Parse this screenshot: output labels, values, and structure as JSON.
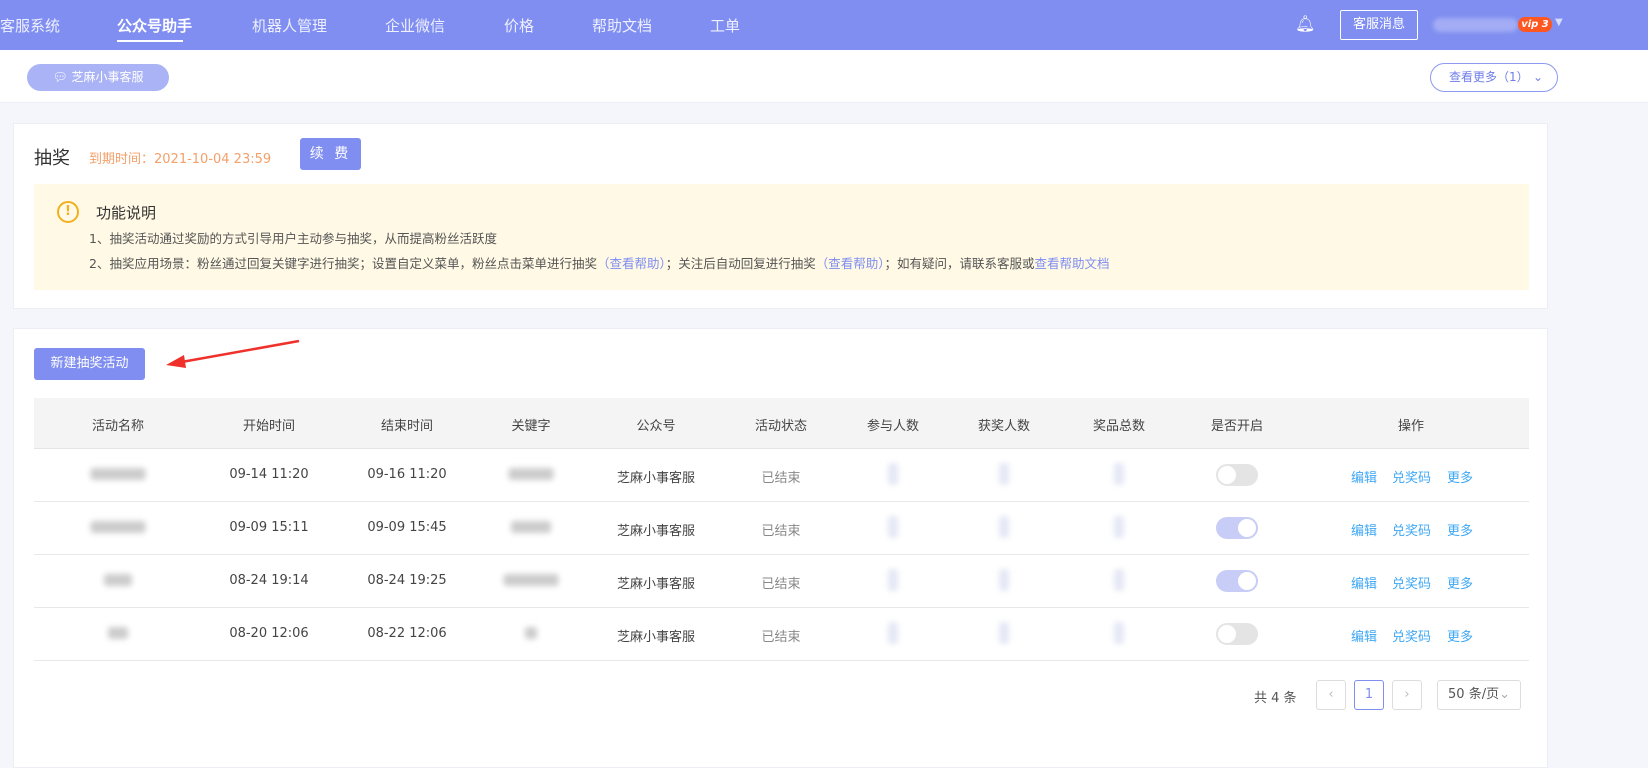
{
  "nav": {
    "items": [
      "客服系统",
      "公众号助手",
      "机器人管理",
      "企业微信",
      "价格",
      "帮助文档",
      "工单"
    ],
    "active": 1,
    "kf_message": "客服消息",
    "vip_badge": "vip 3"
  },
  "subbar": {
    "account": "芝麻小事客服",
    "more": "查看更多（1）"
  },
  "header": {
    "title": "抽奖",
    "expire": "到期时间：2021-10-04 23:59",
    "renew": "续 费"
  },
  "notice": {
    "title": "功能说明",
    "line1": "1、抽奖活动通过奖励的方式引导用户主动参与抽奖，从而提高粉丝活跃度",
    "line2_a": "2、抽奖应用场景：粉丝通过回复关键字进行抽奖；设置自定义菜单，粉丝点击菜单进行抽奖",
    "help1": "（查看帮助）",
    "line2_b": "；关注后自动回复进行抽奖",
    "help2": "（查看帮助）",
    "line2_c": "；如有疑问，请联系客服或",
    "help3": "查看帮助文档"
  },
  "new_button": "新建抽奖活动",
  "table": {
    "headers": [
      "活动名称",
      "开始时间",
      "结束时间",
      "关键字",
      "公众号",
      "活动状态",
      "参与人数",
      "获奖人数",
      "奖品总数",
      "是否开启",
      "操作"
    ],
    "rows": [
      {
        "start": "09-14 11:20",
        "end": "09-16 11:20",
        "account": "芝麻小事客服",
        "status": "已结束",
        "enabled": false
      },
      {
        "start": "09-09 15:11",
        "end": "09-09 15:45",
        "account": "芝麻小事客服",
        "status": "已结束",
        "enabled": true
      },
      {
        "start": "08-24 19:14",
        "end": "08-24 19:25",
        "account": "芝麻小事客服",
        "status": "已结束",
        "enabled": true
      },
      {
        "start": "08-20 12:06",
        "end": "08-22 12:06",
        "account": "芝麻小事客服",
        "status": "已结束",
        "enabled": false
      }
    ],
    "actions": [
      "编辑",
      "兑奖码",
      "更多"
    ]
  },
  "pagination": {
    "total": "共 4 条",
    "page": "1",
    "size": "50 条/页"
  },
  "colors": {
    "accent": "#7f8ef0",
    "link": "#3ea7f5",
    "warning": "#f2b01e"
  }
}
